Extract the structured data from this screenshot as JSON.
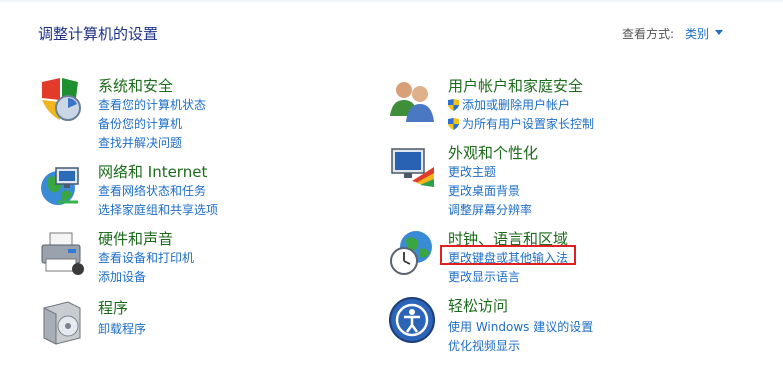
{
  "header": {
    "title": "调整计算机的设置",
    "view_by_label": "查看方式:",
    "view_by_value": "类别"
  },
  "categories": {
    "system": {
      "title": "系统和安全",
      "links": [
        "查看您的计算机状态",
        "备份您的计算机",
        "查找并解决问题"
      ]
    },
    "network": {
      "title": "网络和 Internet",
      "links": [
        "查看网络状态和任务",
        "选择家庭组和共享选项"
      ]
    },
    "hardware": {
      "title": "硬件和声音",
      "links": [
        "查看设备和打印机",
        "添加设备"
      ]
    },
    "programs": {
      "title": "程序",
      "links": [
        "卸载程序"
      ]
    },
    "users": {
      "title": "用户帐户和家庭安全",
      "links": [
        "添加或删除用户帐户",
        "为所有用户设置家长控制"
      ]
    },
    "appearance": {
      "title": "外观和个性化",
      "links": [
        "更改主题",
        "更改桌面背景",
        "调整屏幕分辨率"
      ]
    },
    "clock": {
      "title": "时钟、语言和区域",
      "links": [
        "更改键盘或其他输入法",
        "更改显示语言"
      ]
    },
    "access": {
      "title": "轻松访问",
      "links": [
        "使用 Windows 建议的设置",
        "优化视频显示"
      ]
    }
  },
  "colors": {
    "category_title": "#1b6b1b",
    "link": "#1e6ec8",
    "highlight_border": "#e02020"
  }
}
